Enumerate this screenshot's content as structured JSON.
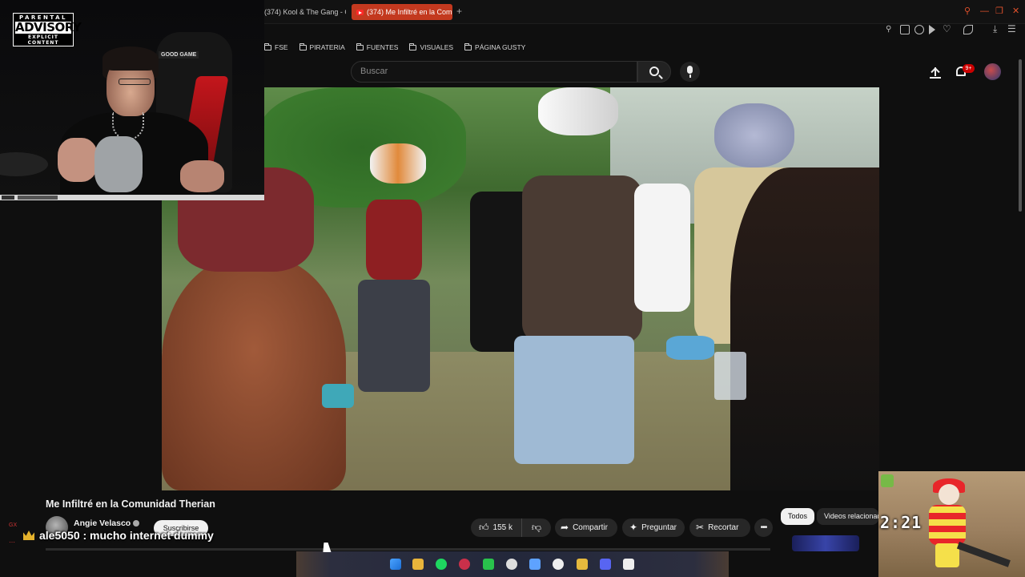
{
  "browser": {
    "tabs": [
      {
        "label": "(374) Kool & The Gang - C",
        "active": false
      },
      {
        "label": "(374) Me Infiltré en la Com",
        "active": true
      }
    ],
    "new_tab": "+",
    "window_controls": [
      "search-icon",
      "minimize-icon",
      "restore-icon",
      "close-icon"
    ],
    "bookmarks": [
      "FSE",
      "PIRATERIA",
      "FUENTES",
      "VISUALES",
      "PÁGINA GUSTY"
    ]
  },
  "youtube": {
    "search_placeholder": "Buscar",
    "notifications_badge": "9+",
    "video_title": "Me Infiltré en la Comunidad Therian",
    "channel_name": "Angie Velasco",
    "subscribe_label": "Suscribirse",
    "like_count": "155 k",
    "actions": {
      "share": "Compartir",
      "ask": "Preguntar",
      "clip": "Recortar",
      "more": "•••"
    },
    "chips": [
      "Todos",
      "Videos relacionados"
    ]
  },
  "stream_overlay": {
    "advisory": {
      "top": "PARENTAL",
      "mid": "ADVISORY",
      "bottom": "EXPLICIT CONTENT"
    },
    "chair_label": "GOOD GAME",
    "chat": {
      "user": "ale5050",
      "message": " : mucho internet dummy"
    },
    "gx_label": "GX",
    "game_timer": "2:21"
  },
  "colors": {
    "accent_tab": "#c3391f",
    "youtube_red": "#cc0000",
    "bg": "#0f0f0f"
  }
}
